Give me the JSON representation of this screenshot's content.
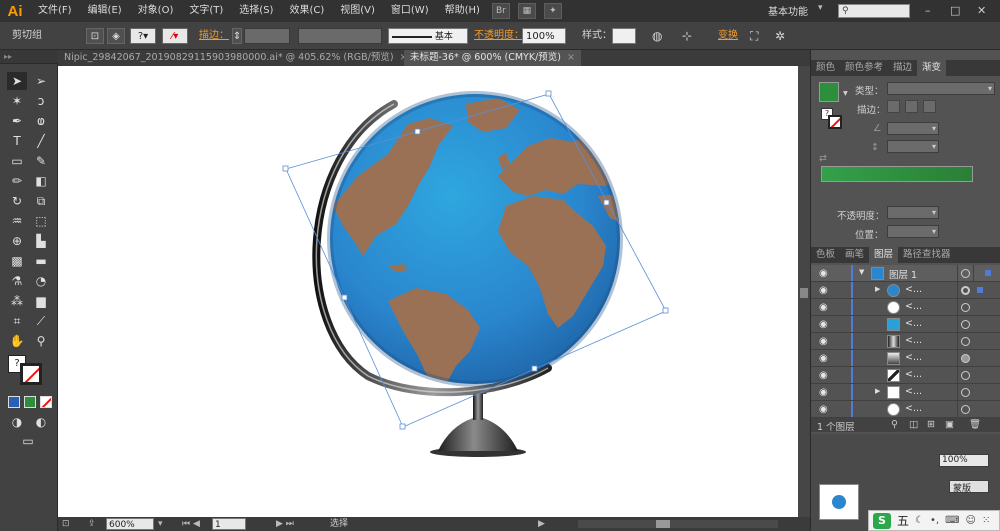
{
  "app": {
    "logo": "Ai",
    "workspace": "基本功能",
    "window_controls": [
      "–",
      "□",
      "✕"
    ]
  },
  "menu": [
    "文件(F)",
    "编辑(E)",
    "对象(O)",
    "文字(T)",
    "选择(S)",
    "效果(C)",
    "视图(V)",
    "窗口(W)",
    "帮助(H)"
  ],
  "control_bar": {
    "selection_label": "剪切组",
    "stroke_label": "描边：",
    "brush_label": "基本",
    "opacity_label": "不透明度：",
    "opacity_value": "100%",
    "style_label": "样式：",
    "transform_label": "变换"
  },
  "tabs": [
    {
      "label": "Nipic_29842067_20190829115903980000.ai* @ 405.62% (RGB/预览)",
      "close": "×"
    },
    {
      "label": "未标题-36* @ 600% (CMYK/预览)",
      "close": "×"
    }
  ],
  "status_bar": {
    "zoom": "600%",
    "artboard": "1",
    "mode": "选择"
  },
  "gradient_panel": {
    "tabs": [
      "颜色",
      "颜色参考",
      "描边",
      "渐变"
    ],
    "type_label": "类型：",
    "stroke_label": "描边：",
    "opacity_label": "不透明度：",
    "position_label": "位置：",
    "swatch_color": "#2d8f3c",
    "gradient_start": "#34a04a",
    "gradient_end": "#2a7f36"
  },
  "layers_panel": {
    "tabs": [
      "色板",
      "画笔",
      "图层",
      "路径查找器"
    ],
    "layer_name": "图层 1",
    "sublayer_name": "<...",
    "footer": "1 个图层",
    "appearance_opacity": "100%",
    "appearance_tab": "蒙版"
  },
  "ime": {
    "brand": "S",
    "mode": "五"
  },
  "globe": {
    "ocean": "#2a8ad0",
    "ocean_dark": "#1d5ea0",
    "land": "#9a7155"
  }
}
